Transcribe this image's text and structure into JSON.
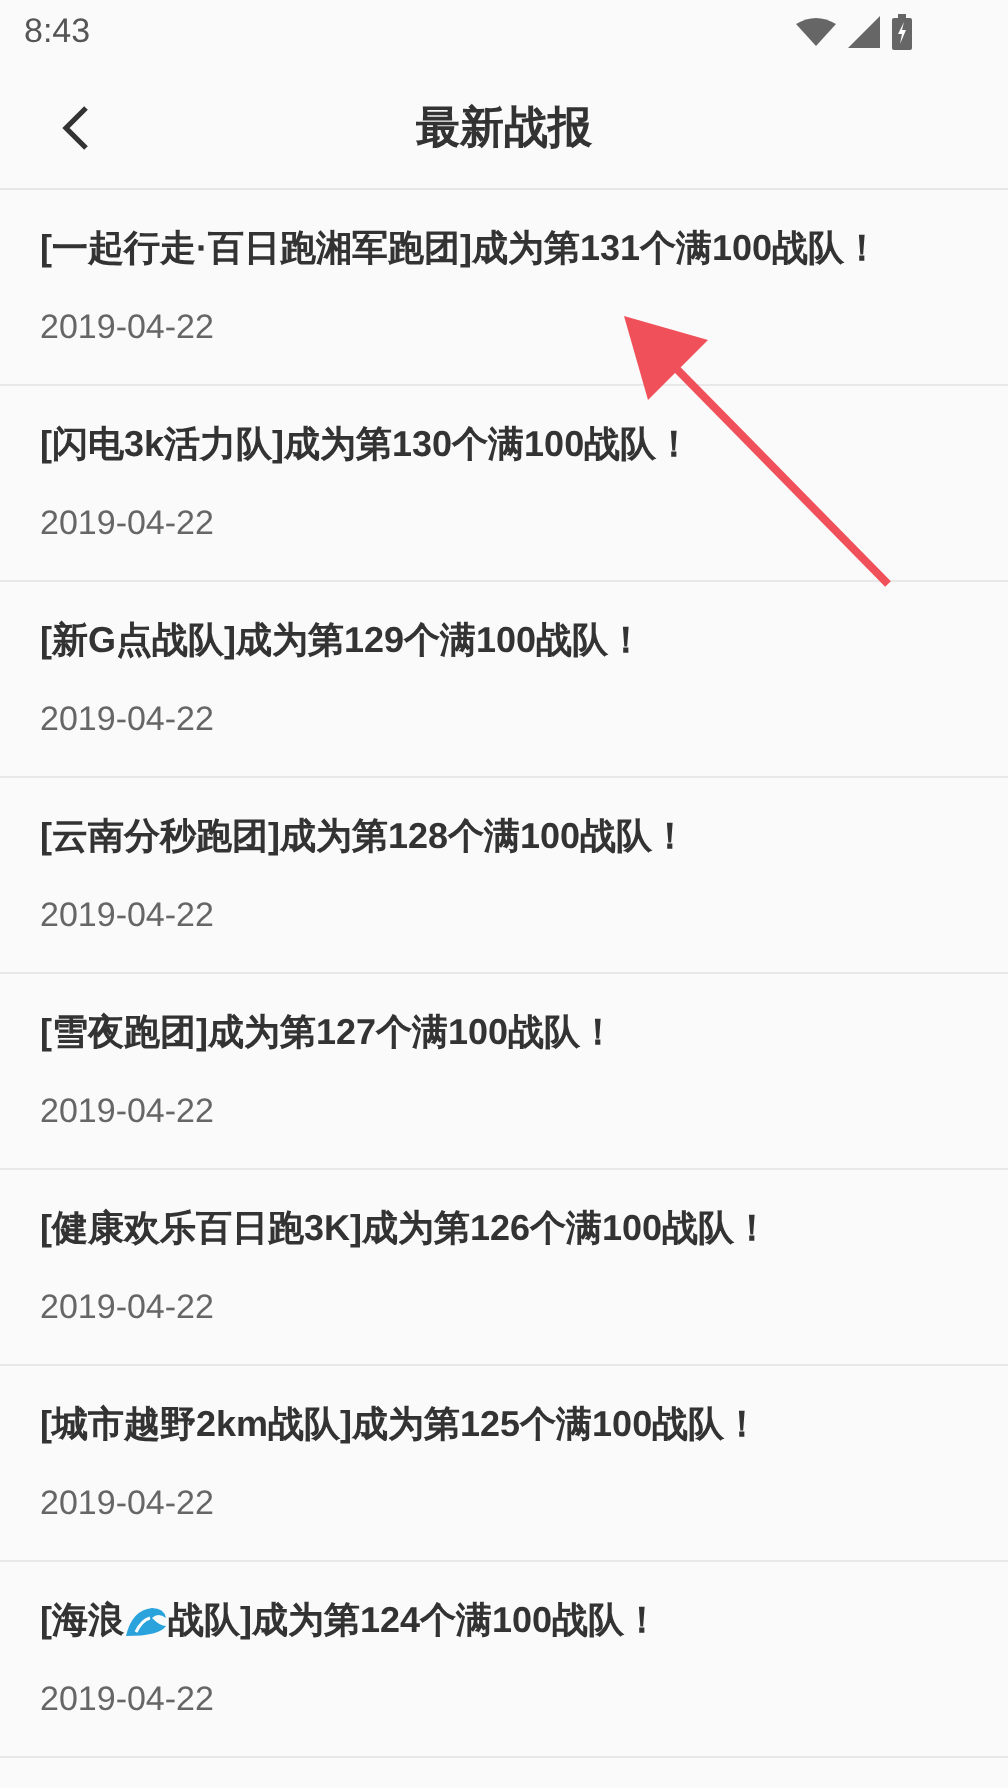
{
  "status_bar": {
    "time": "8:43"
  },
  "header": {
    "title": "最新战报"
  },
  "reports": [
    {
      "title": [
        "[一起行走·百日跑湘军跑团]成为第131个满100战队！"
      ],
      "date": "2019-04-22"
    },
    {
      "title": [
        "[闪电3k活力队]成为第130个满100战队！"
      ],
      "date": "2019-04-22"
    },
    {
      "title": [
        "[新G点战队]成为第129个满100战队！"
      ],
      "date": "2019-04-22"
    },
    {
      "title": [
        "[云南分秒跑团]成为第128个满100战队！"
      ],
      "date": "2019-04-22"
    },
    {
      "title": [
        "[雪夜跑团]成为第127个满100战队！"
      ],
      "date": "2019-04-22"
    },
    {
      "title": [
        "[健康欢乐百日跑3K]成为第126个满100战队！"
      ],
      "date": "2019-04-22"
    },
    {
      "title": [
        "[城市越野2km战队]成为第125个满100战队！"
      ],
      "date": "2019-04-22"
    },
    {
      "title": [
        "[海浪",
        "战队]成为第124个满100战队！"
      ],
      "date": "2019-04-22"
    }
  ]
}
